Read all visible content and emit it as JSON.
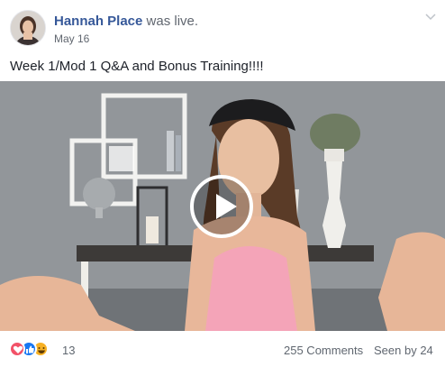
{
  "post": {
    "author_name": "Hannah Place",
    "author_action": "was live.",
    "date": "May 16",
    "text": "Week 1/Mod 1 Q&A and Bonus Training!!!!",
    "avatar_icon": "profile-photo",
    "menu_icon": "chevron-down-icon"
  },
  "video": {
    "play_icon": "play-icon"
  },
  "footer": {
    "reaction_icons": [
      "love-icon",
      "like-icon",
      "haha-icon"
    ],
    "reaction_count": "13",
    "comments": "255 Comments",
    "seen_by": "Seen by 24"
  },
  "colors": {
    "link": "#365899",
    "secondary_text": "#616770",
    "love": "#f25268",
    "like": "#1877f2",
    "haha": "#f7b125"
  }
}
